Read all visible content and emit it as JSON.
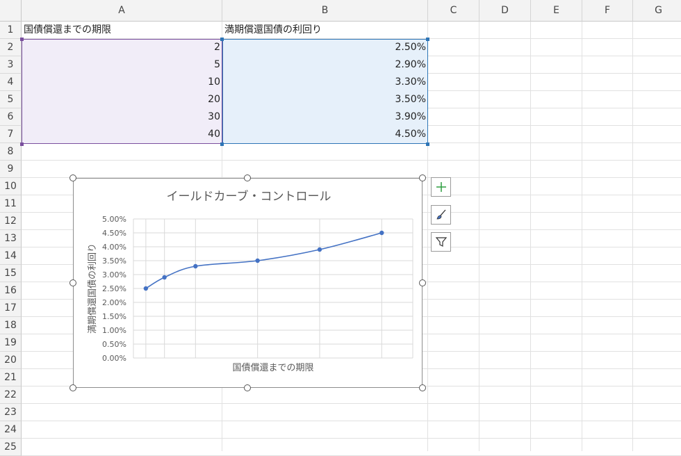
{
  "columns": [
    "A",
    "B",
    "C",
    "D",
    "E",
    "F",
    "G"
  ],
  "rows": [
    "1",
    "2",
    "3",
    "4",
    "5",
    "6",
    "7",
    "8",
    "9",
    "10",
    "11",
    "12",
    "13",
    "14",
    "15",
    "16",
    "17",
    "18",
    "19",
    "20",
    "21",
    "22",
    "23",
    "24",
    "25"
  ],
  "header_row": {
    "a": "国債償還までの期限",
    "b": "満期償還国債の利回り"
  },
  "table": [
    {
      "a": "2",
      "b": "2.50%"
    },
    {
      "a": "5",
      "b": "2.90%"
    },
    {
      "a": "10",
      "b": "3.30%"
    },
    {
      "a": "20",
      "b": "3.50%"
    },
    {
      "a": "30",
      "b": "3.90%"
    },
    {
      "a": "40",
      "b": "4.50%"
    }
  ],
  "colors": {
    "series": "#4472c4",
    "selA": "#7a4f9e",
    "selB": "#2e75b6",
    "plus": "#2e9e40"
  },
  "side_buttons": [
    "chart-elements-icon",
    "chart-styles-icon",
    "chart-filters-icon"
  ],
  "chart_data": {
    "type": "line",
    "smoothed": true,
    "title": "イールドカーブ・コントロール",
    "xlabel": "国債償還までの期限",
    "ylabel": "満期償還国債の利回り",
    "x": [
      2,
      5,
      10,
      20,
      30,
      40
    ],
    "series": [
      {
        "values": [
          2.5,
          2.9,
          3.3,
          3.5,
          3.9,
          4.5
        ]
      }
    ],
    "ylim": [
      0,
      5
    ],
    "yticks": [
      "0.00%",
      "0.50%",
      "1.00%",
      "1.50%",
      "2.00%",
      "2.50%",
      "3.00%",
      "3.50%",
      "4.00%",
      "4.50%",
      "5.00%"
    ],
    "grid": true,
    "legend": "none"
  }
}
